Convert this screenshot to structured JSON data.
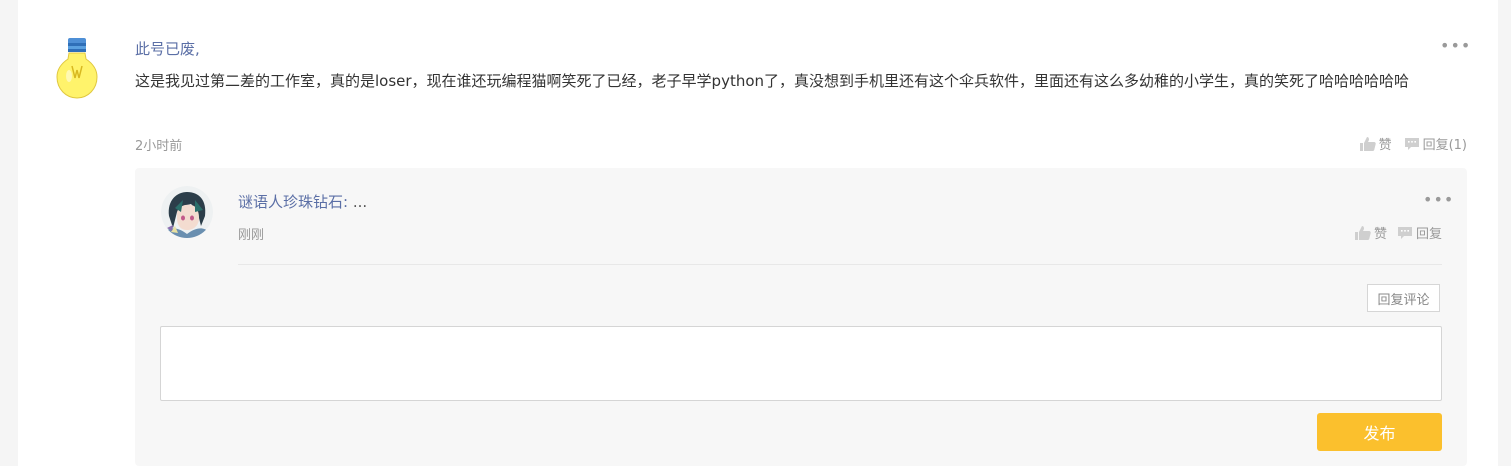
{
  "comment": {
    "username": "此号已废,",
    "text": "这是我见过第二差的工作室，真的是loser，现在谁还玩编程猫啊笑死了已经，老子早学python了，真没想到手机里还有这个伞兵软件，里面还有这么多幼稚的小学生，真的笑死了哈哈哈哈哈哈",
    "time": "2小时前",
    "more_label": "•••",
    "like_label": "赞",
    "reply_label": "回复(1)",
    "avatar_icon": "lightbulb-icon"
  },
  "reply": {
    "username": "谜语人珍珠钻石:",
    "text": "...",
    "time": "刚刚",
    "more_label": "•••",
    "like_label": "赞",
    "reply_label": "回复",
    "avatar_icon": "anime-avatar"
  },
  "reply_form": {
    "reply_comment_label": "回复评论",
    "input_value": "",
    "input_placeholder": "",
    "publish_label": "发布"
  },
  "colors": {
    "accent": "#fbc02d",
    "username": "#5b6fa6",
    "muted": "#999999"
  }
}
